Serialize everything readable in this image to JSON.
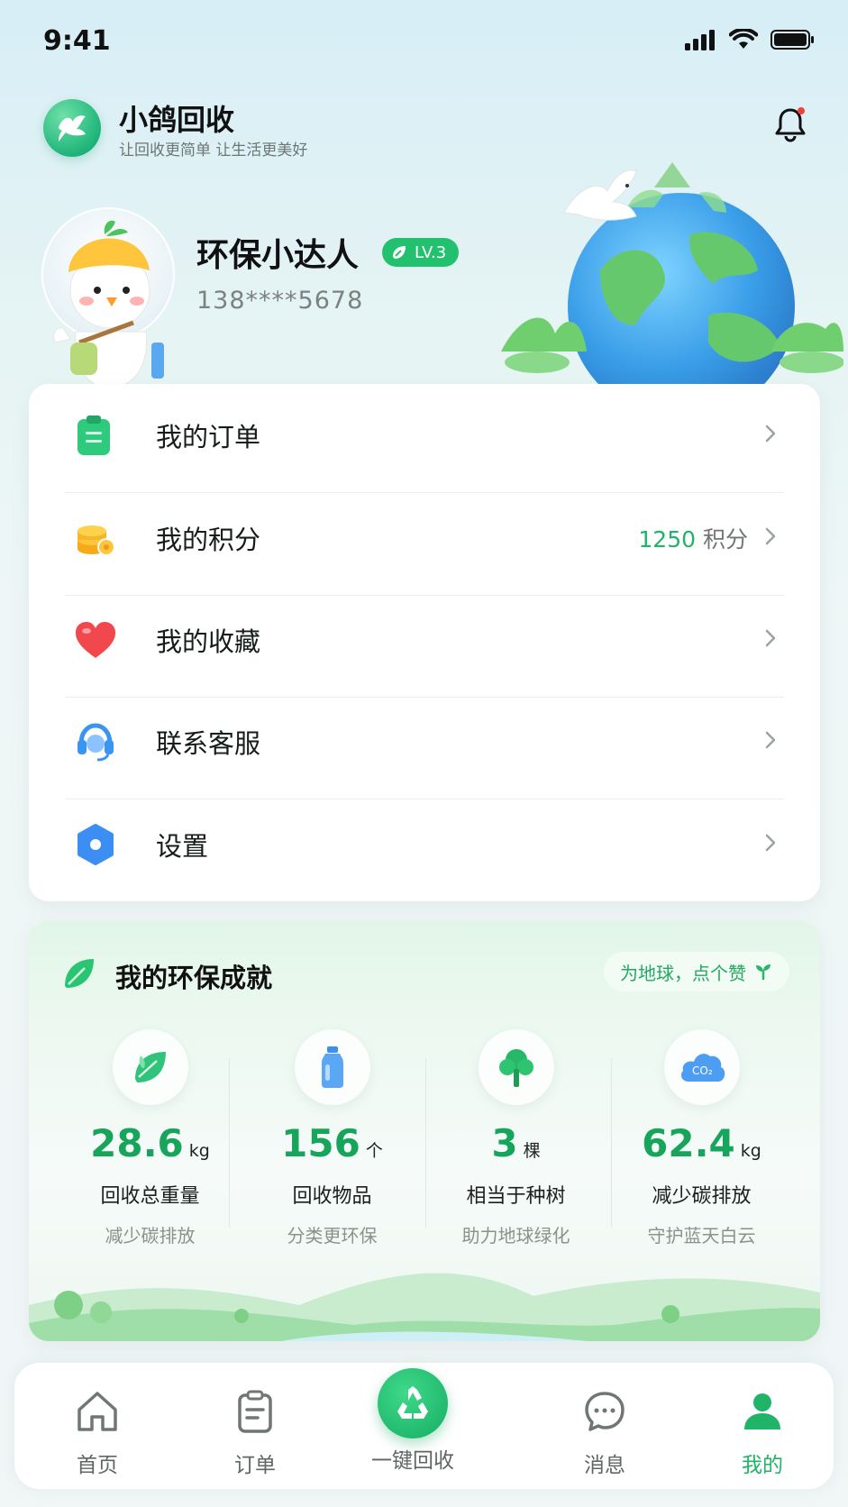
{
  "status_bar": {
    "time": "9:41"
  },
  "header": {
    "app_name": "小鸽回收",
    "slogan": "让回收更简单 让生活更美好"
  },
  "profile": {
    "nickname": "环保小达人",
    "level": "LV.3",
    "phone": "138****5678"
  },
  "menu": [
    {
      "label": "我的订单",
      "icon": "clipboard-icon",
      "extra_value": "",
      "extra_unit": ""
    },
    {
      "label": "我的积分",
      "icon": "coins-icon",
      "extra_value": "1250",
      "extra_unit": "积分"
    },
    {
      "label": "我的收藏",
      "icon": "heart-icon",
      "extra_value": "",
      "extra_unit": ""
    },
    {
      "label": "联系客服",
      "icon": "headset-icon",
      "extra_value": "",
      "extra_unit": ""
    },
    {
      "label": "设置",
      "icon": "settings-hex-icon",
      "extra_value": "",
      "extra_unit": ""
    }
  ],
  "achievement": {
    "title": "我的环保成就",
    "like_label": "为地球，点个赞",
    "stats": [
      {
        "value": "28.6",
        "unit": "kg",
        "label": "回收总重量",
        "sub": "减少碳排放",
        "icon": "leaf-icon"
      },
      {
        "value": "156",
        "unit": "个",
        "label": "回收物品",
        "sub": "分类更环保",
        "icon": "bottle-icon"
      },
      {
        "value": "3",
        "unit": "棵",
        "label": "相当于种树",
        "sub": "助力地球绿化",
        "icon": "tree-icon"
      },
      {
        "value": "62.4",
        "unit": "kg",
        "label": "减少碳排放",
        "sub": "守护蓝天白云",
        "icon": "co2-cloud-icon"
      }
    ]
  },
  "tab_bar": {
    "items": [
      {
        "label": "首页",
        "icon": "home-icon",
        "active": false
      },
      {
        "label": "订单",
        "icon": "order-icon",
        "active": false
      },
      {
        "label": "一键回收",
        "icon": "recycle-icon",
        "active": false
      },
      {
        "label": "消息",
        "icon": "message-icon",
        "active": false
      },
      {
        "label": "我的",
        "icon": "user-icon",
        "active": true
      }
    ]
  },
  "colors": {
    "accent": "#1fb467",
    "primary_text": "#161c19",
    "secondary_text": "#7b827f"
  }
}
